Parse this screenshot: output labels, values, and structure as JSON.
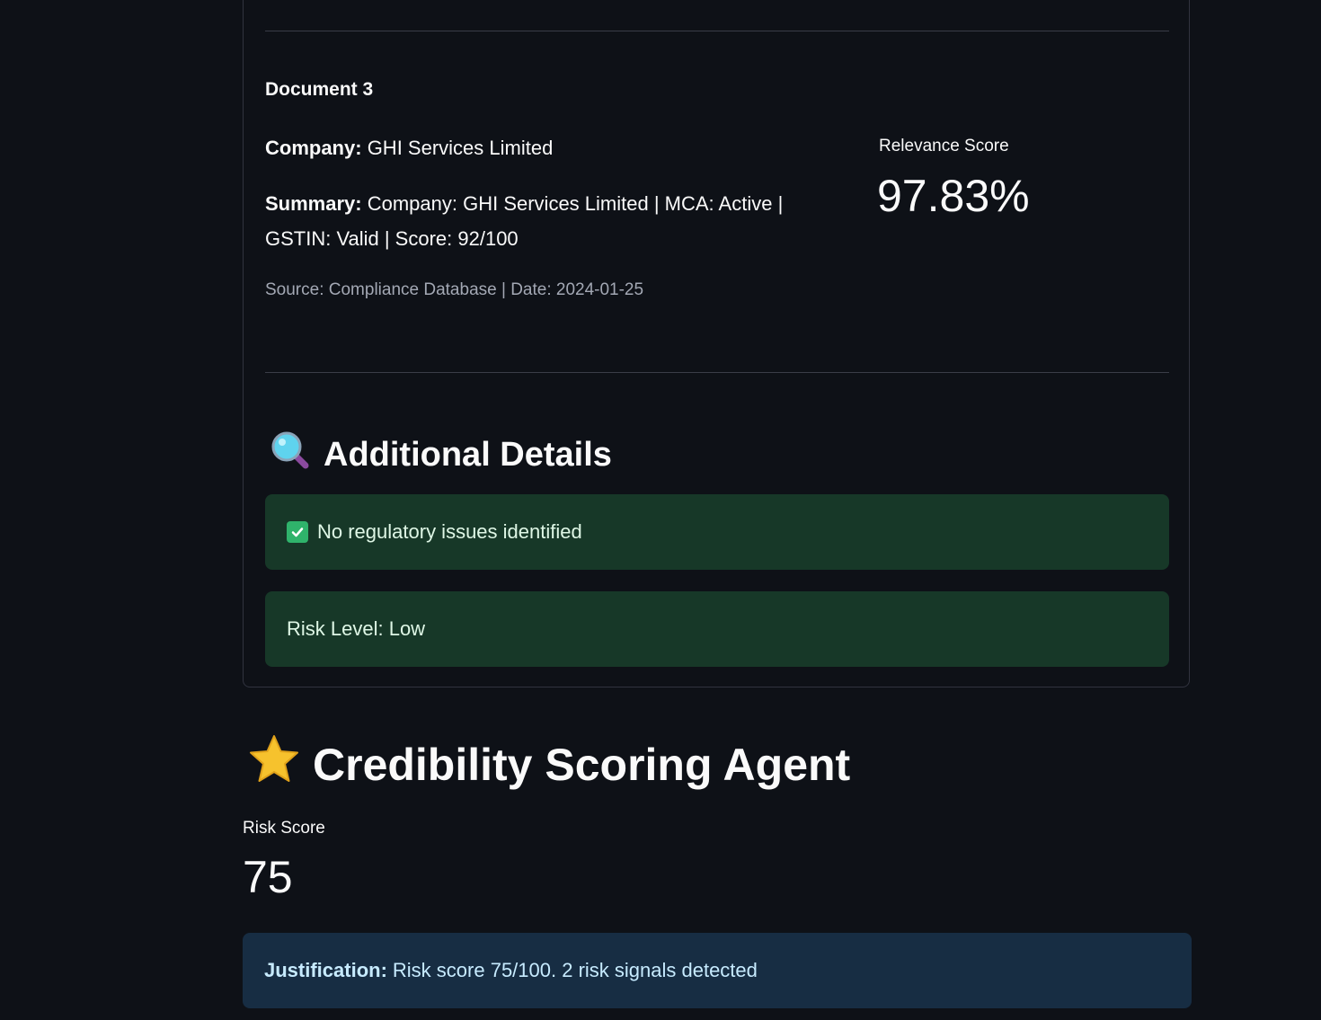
{
  "document": {
    "title": "Document 3",
    "company_label": "Company:",
    "company_value": "GHI Services Limited",
    "summary_label": "Summary:",
    "summary_value": "Company: GHI Services Limited | MCA: Active | GSTIN: Valid | Score: 92/100",
    "source": "Source: Compliance Database | Date: 2024-01-25",
    "relevance_label": "Relevance Score",
    "relevance_value": "97.83%"
  },
  "additional_details": {
    "title": "Additional Details",
    "icon": "magnifying-glass-icon",
    "regulatory_status": "No regulatory issues identified",
    "risk_level": "Risk Level: Low"
  },
  "credibility": {
    "title": "Credibility Scoring Agent",
    "icon": "star-icon",
    "risk_score_label": "Risk Score",
    "risk_score_value": "75",
    "justification_label": "Justification:",
    "justification_text": "Risk score 75/100. 2 risk signals detected"
  },
  "colors": {
    "background": "#0e1117",
    "success_bg": "#173828",
    "info_bg": "#172d43",
    "success_text": "#dff7e6",
    "info_text": "#c7ebff"
  }
}
